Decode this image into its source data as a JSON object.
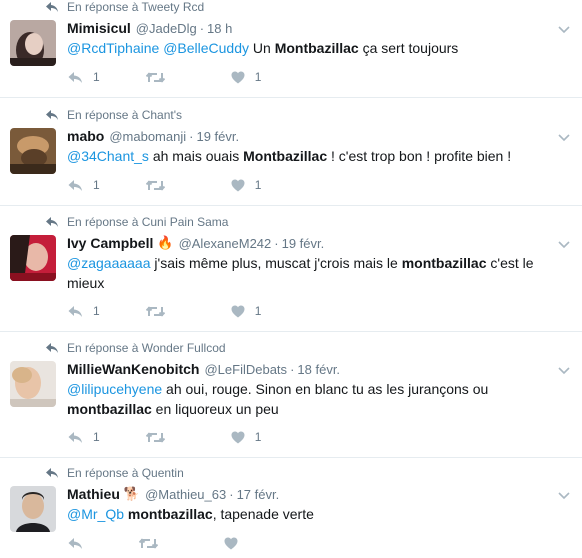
{
  "colors": {
    "link": "#1b95e0",
    "muted": "#657786",
    "icon": "#aab8c2",
    "divider": "#e6ecf0"
  },
  "tweets": [
    {
      "context": "En réponse à Tweety Rcd",
      "name": "Mimisicul",
      "handle": "@JadeDlg",
      "time": "18 h",
      "badge": "",
      "m1": "@RcdTiphaine",
      "m2": "@BelleCuddy",
      "t1": " Un ",
      "h1": "Montbazillac",
      "t2": " ça sert toujours",
      "replies": "1",
      "likes": "1"
    },
    {
      "context": "En réponse à Chant's",
      "name": "mabo",
      "handle": "@mabomanji",
      "time": "19 févr.",
      "badge": "",
      "m1": "@34Chant_s",
      "t1": " ah mais ouais ",
      "h1": "Montbazillac",
      "t2": " ! c'est trop bon ! profite bien !",
      "replies": "1",
      "likes": "1"
    },
    {
      "context": "En réponse à Cuni Pain Sama",
      "name": "Ivy Campbell",
      "handle": "@AlexaneM242",
      "time": "19 févr.",
      "badge": "🔥",
      "m1": "@zagaaaaaa",
      "t1": " j'sais même plus, muscat j'crois mais le ",
      "h1": "montbazillac",
      "t2": " c'est le mieux",
      "replies": "1",
      "likes": "1"
    },
    {
      "context": "En réponse à Wonder Fullcod",
      "name": "MillieWanKenobitch",
      "handle": "@LeFilDebats",
      "time": "18 févr.",
      "badge": "",
      "m1": "@lilipucehyene",
      "t1": " ah oui, rouge. Sinon en blanc tu as les jurançons ou ",
      "h1": "montbazillac",
      "t2": " en liquoreux un peu",
      "replies": "1",
      "likes": "1"
    },
    {
      "context": "En réponse à Quentin",
      "name": "Mathieu",
      "handle": "@Mathieu_63",
      "time": "17 févr.",
      "badge": "🐕",
      "m1": "@Mr_Qb",
      "t1": " ",
      "h1": "montbazillac",
      "t2": ", tapenade verte",
      "replies": "",
      "likes": ""
    }
  ]
}
